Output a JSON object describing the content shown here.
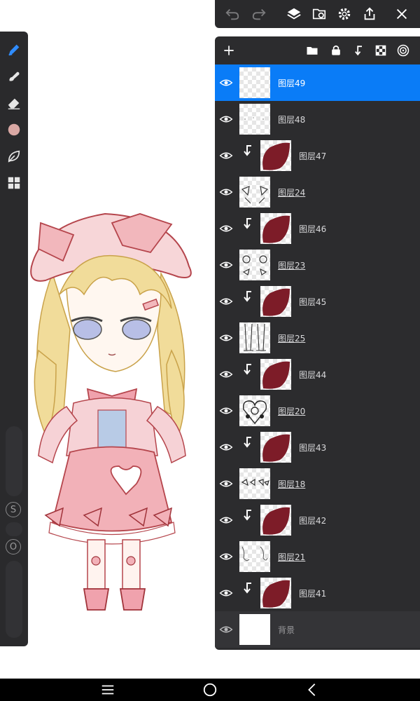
{
  "app": {
    "accent_color": "#0a7cf7",
    "panel_color": "#2c2c2e"
  },
  "tools": [
    {
      "name": "brush-tool",
      "icon": "pen-icon",
      "active": true
    },
    {
      "name": "smudge-tool",
      "icon": "smudge-icon"
    },
    {
      "name": "eraser-tool",
      "icon": "eraser-icon"
    },
    {
      "name": "color-swatch",
      "icon": "color-circle",
      "color": "#d9a8a4"
    },
    {
      "name": "leaf-tool",
      "icon": "leaf-icon"
    },
    {
      "name": "gallery-tool",
      "icon": "grid-icon"
    }
  ],
  "sliders": {
    "size_label": "S",
    "opacity_label": "O"
  },
  "top_toolbar": [
    "undo-icon",
    "redo-icon",
    "layers-icon",
    "gallery-import-icon",
    "settings-icon",
    "share-icon",
    "close-icon"
  ],
  "layer_panel": {
    "header_icons": [
      "add-icon",
      "folder-icon",
      "lock-icon",
      "clip-icon",
      "checker-icon",
      "blend-icon"
    ],
    "layers": [
      {
        "name": "图层49",
        "thumb": "empty",
        "clipped": false,
        "underlined": false,
        "selected": true
      },
      {
        "name": "图层48",
        "thumb": "faint",
        "clipped": false,
        "underlined": false
      },
      {
        "name": "图层47",
        "thumb": "red-shape",
        "clipped": true,
        "underlined": false
      },
      {
        "name": "图层24",
        "thumb": "lineart-bows",
        "clipped": false,
        "underlined": true
      },
      {
        "name": "图层46",
        "thumb": "red-shape",
        "clipped": true,
        "underlined": false
      },
      {
        "name": "图层23",
        "thumb": "lineart-flowers",
        "clipped": false,
        "underlined": true
      },
      {
        "name": "图层45",
        "thumb": "red-shape",
        "clipped": true,
        "underlined": false
      },
      {
        "name": "图层25",
        "thumb": "lineart-legs",
        "clipped": false,
        "underlined": true
      },
      {
        "name": "图层44",
        "thumb": "red-shape",
        "clipped": true,
        "underlined": false
      },
      {
        "name": "图层20",
        "thumb": "lineart-heart",
        "clipped": false,
        "underlined": true
      },
      {
        "name": "图层43",
        "thumb": "red-shape",
        "clipped": true,
        "underlined": false
      },
      {
        "name": "图层18",
        "thumb": "lineart-small",
        "clipped": false,
        "underlined": true
      },
      {
        "name": "图层42",
        "thumb": "red-shape",
        "clipped": true,
        "underlined": false
      },
      {
        "name": "图层21",
        "thumb": "lineart-sketch",
        "clipped": false,
        "underlined": true
      },
      {
        "name": "图层41",
        "thumb": "red-shape",
        "clipped": true,
        "underlined": false
      },
      {
        "name": "背景",
        "thumb": "white",
        "clipped": false,
        "underlined": false,
        "background": true
      }
    ]
  },
  "bottom_nav": [
    "menu-icon",
    "home-icon",
    "back-icon"
  ]
}
